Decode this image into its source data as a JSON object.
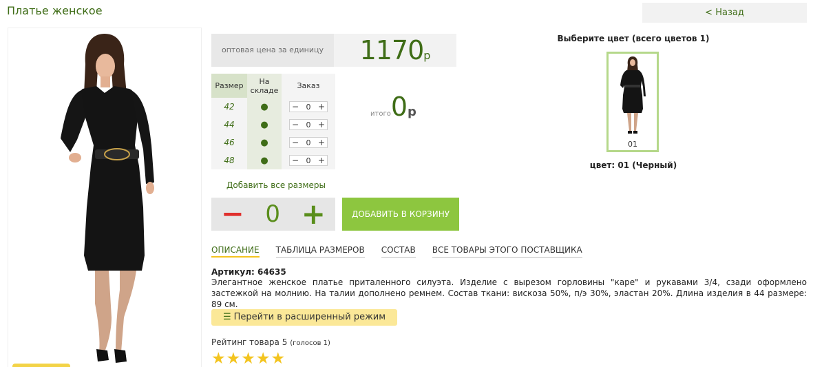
{
  "page": {
    "title": "Платье женское",
    "back_label": "< Назад"
  },
  "price": {
    "label": "оптовая цена за единицу",
    "value": "1170",
    "currency": "р"
  },
  "size_table": {
    "headers": [
      "Размер",
      "На складе",
      "Заказ"
    ],
    "rows": [
      {
        "size": "42",
        "stock": "●",
        "qty": "0"
      },
      {
        "size": "44",
        "stock": "●",
        "qty": "0"
      },
      {
        "size": "46",
        "stock": "●",
        "qty": "0"
      },
      {
        "size": "48",
        "stock": "●",
        "qty": "0"
      }
    ],
    "minus": "−",
    "plus": "+"
  },
  "total": {
    "label": "итого",
    "value": "0",
    "currency": "р"
  },
  "add_all_sizes": "Добавить все размеры",
  "quantity": {
    "minus": "−",
    "value": "0",
    "plus": "+"
  },
  "cart_button": "ДОБАВИТЬ В КОРЗИНУ",
  "tabs": [
    "ОПИСАНИЕ",
    "ТАБЛИЦА РАЗМЕРОВ",
    "СОСТАВ",
    "ВСЕ ТОВАРЫ ЭТОГО ПОСТАВЩИКА"
  ],
  "description": {
    "article": "Артикул: 64635",
    "text": "Элегантное женское платье приталенного силуэта. Изделие с вырезом горловины \"каре\" и рукавами 3/4, сзади оформлено застежкой на молнию. На талии дополнено ремнем. Состав ткани: вискоза 50%, п/э 30%, эластан 20%. Длина изделия в 44 размере: 89 см."
  },
  "advanced_mode": {
    "icon": "list-icon",
    "label": "Перейти в расширенный режим"
  },
  "rating": {
    "text": "Рейтинг товара 5",
    "votes": "(голосов 1)",
    "stars": 5
  },
  "colors": {
    "title": "Выберите цвет (всего цветов 1)",
    "swatch_code": "01",
    "caption": "цвет: 01 (Черный)"
  },
  "theme": {
    "green": "#3f6d17",
    "button_green": "#8dc63f",
    "red": "#e0302d",
    "star": "#f3c41f"
  }
}
